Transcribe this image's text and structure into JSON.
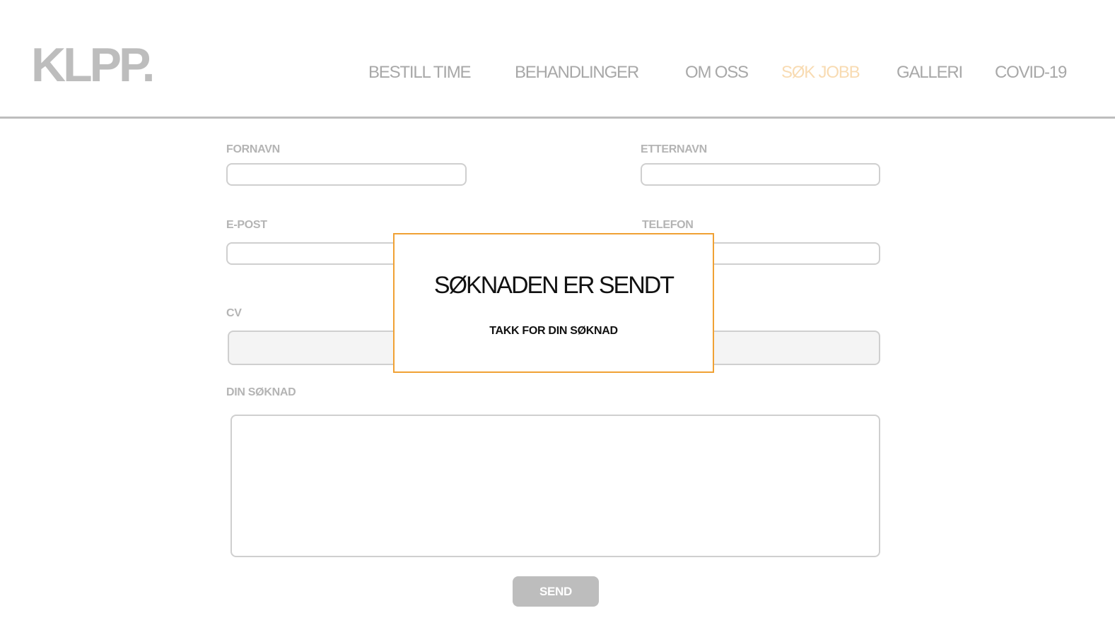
{
  "header": {
    "logo": "KLPP.",
    "nav": [
      {
        "label": "BESTILL TIME",
        "active": false
      },
      {
        "label": "BEHANDLINGER",
        "active": false
      },
      {
        "label": "OM OSS",
        "active": false
      },
      {
        "label": "SØK JOBB",
        "active": true
      },
      {
        "label": "GALLERI",
        "active": false
      },
      {
        "label": "COVID-19",
        "active": false
      }
    ]
  },
  "form": {
    "first_name": {
      "label": "FORNAVN",
      "value": ""
    },
    "last_name": {
      "label": "ETTERNAVN",
      "value": ""
    },
    "email": {
      "label": "E-POST",
      "value": ""
    },
    "phone": {
      "label": "TELEFON",
      "value": ""
    },
    "cv": {
      "label": "CV"
    },
    "application": {
      "label": "DIN SØKNAD",
      "value": ""
    },
    "send_label": "SEND"
  },
  "modal": {
    "title": "SØKNADEN ER SENDT",
    "message": "TAKK FOR DIN SØKNAD"
  },
  "colors": {
    "accent_border": "#f0a134",
    "active_nav": "#f8dbb2",
    "muted_gray": "#bdbdbd"
  }
}
